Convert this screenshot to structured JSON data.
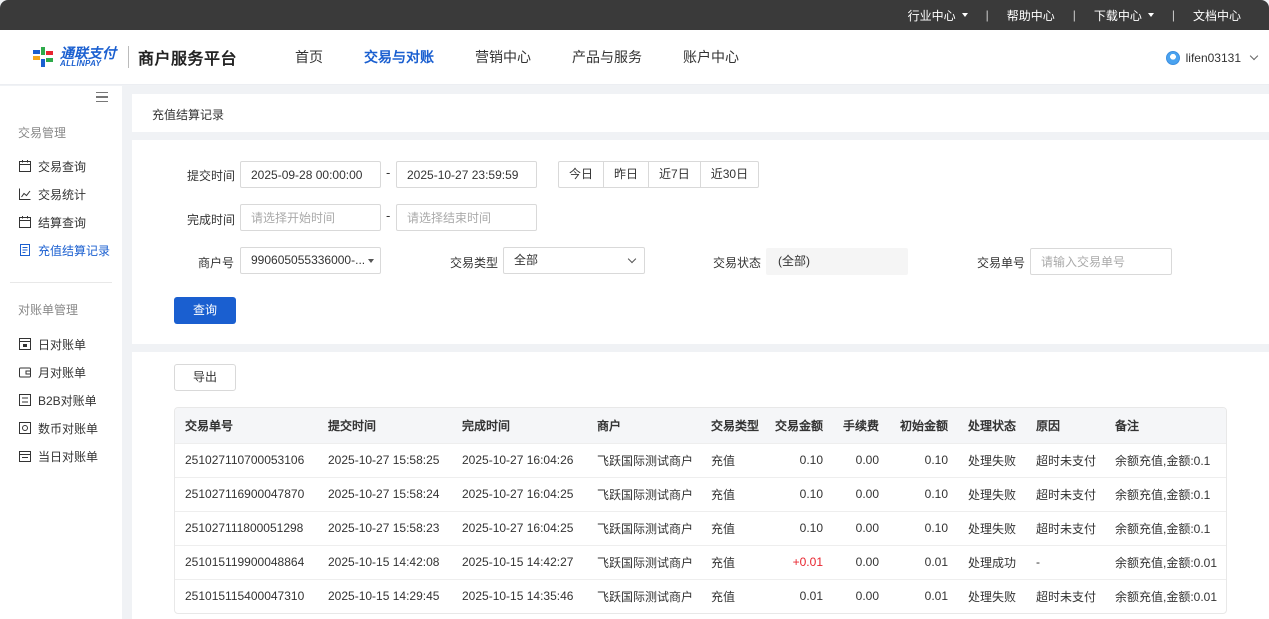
{
  "topbar": {
    "items": [
      {
        "label": "行业中心",
        "dropdown": true
      },
      {
        "label": "帮助中心",
        "dropdown": false
      },
      {
        "label": "下载中心",
        "dropdown": true
      },
      {
        "label": "文档中心",
        "dropdown": false
      }
    ],
    "separator": "|"
  },
  "header": {
    "logo_cn": "通联支付",
    "logo_en": "ALLINPAY",
    "platform_title": "商户服务平台",
    "nav": [
      "首页",
      "交易与对账",
      "营销中心",
      "产品与服务",
      "账户中心"
    ],
    "active_nav": "交易与对账",
    "username": "lifen03131"
  },
  "sidebar": {
    "group1": "交易管理",
    "items1": [
      {
        "label": "交易查询",
        "icon": "calendar-icon"
      },
      {
        "label": "交易统计",
        "icon": "chart-icon"
      },
      {
        "label": "结算查询",
        "icon": "calendar-icon"
      },
      {
        "label": "充值结算记录",
        "icon": "document-icon",
        "active": true
      }
    ],
    "group2": "对账单管理",
    "items2": [
      {
        "label": "日对账单",
        "icon": "daily-statement-icon"
      },
      {
        "label": "月对账单",
        "icon": "wallet-icon"
      },
      {
        "label": "B2B对账单",
        "icon": "b2b-icon"
      },
      {
        "label": "数币对账单",
        "icon": "digital-currency-icon"
      },
      {
        "label": "当日对账单",
        "icon": "today-statement-icon"
      }
    ]
  },
  "breadcrumb": "充值结算记录",
  "filters": {
    "submit_time_label": "提交时间",
    "submit_start": "2025-09-28 00:00:00",
    "submit_end": "2025-10-27 23:59:59",
    "dash": "-",
    "quick": [
      "今日",
      "昨日",
      "近7日",
      "近30日"
    ],
    "complete_time_label": "完成时间",
    "complete_start_placeholder": "请选择开始时间",
    "complete_end_placeholder": "请选择结束时间",
    "merchant_label": "商户号",
    "merchant_value": "990605055336000-...",
    "trade_type_label": "交易类型",
    "trade_type_value": "全部",
    "trade_status_label": "交易状态",
    "trade_status_value": "(全部)",
    "trade_no_label": "交易单号",
    "trade_no_placeholder": "请输入交易单号",
    "query_button": "查询"
  },
  "table": {
    "export_button": "导出",
    "columns": [
      "交易单号",
      "提交时间",
      "完成时间",
      "商户",
      "交易类型",
      "交易金额",
      "手续费",
      "初始金额",
      "处理状态",
      "原因",
      "备注"
    ],
    "rows": [
      [
        "251027110700053106",
        "2025-10-27 15:58:25",
        "2025-10-27 16:04:26",
        "飞跃国际测试商户",
        "充值",
        "0.10",
        "0.00",
        "0.10",
        "处理失败",
        "超时未支付",
        "余额充值,金额:0.1"
      ],
      [
        "251027116900047870",
        "2025-10-27 15:58:24",
        "2025-10-27 16:04:25",
        "飞跃国际测试商户",
        "充值",
        "0.10",
        "0.00",
        "0.10",
        "处理失败",
        "超时未支付",
        "余额充值,金额:0.1"
      ],
      [
        "251027111800051298",
        "2025-10-27 15:58:23",
        "2025-10-27 16:04:25",
        "飞跃国际测试商户",
        "充值",
        "0.10",
        "0.00",
        "0.10",
        "处理失败",
        "超时未支付",
        "余额充值,金额:0.1"
      ],
      [
        "251015119900048864",
        "2025-10-15 14:42:08",
        "2025-10-15 14:42:27",
        "飞跃国际测试商户",
        "充值",
        "+0.01",
        "0.00",
        "0.01",
        "处理成功",
        "-",
        "余额充值,金额:0.01"
      ],
      [
        "251015115400047310",
        "2025-10-15 14:29:45",
        "2025-10-15 14:35:46",
        "飞跃国际测试商户",
        "充值",
        "0.01",
        "0.00",
        "0.01",
        "处理失败",
        "超时未支付",
        "余额充值,金额:0.01"
      ]
    ]
  },
  "colors": {
    "primary": "#1a5fd0",
    "topbar": "#3a3a3a",
    "positive_amount": "#e8252f"
  }
}
